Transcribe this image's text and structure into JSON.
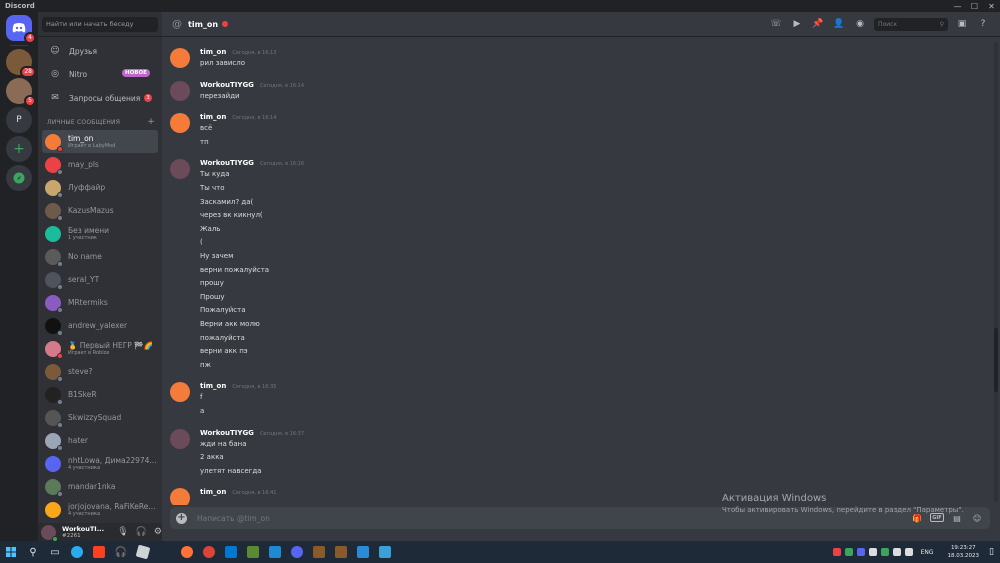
{
  "window": {
    "title": "Discord"
  },
  "guilds": {
    "home_badge": "4",
    "items": [
      {
        "label": "",
        "badge": "28",
        "color": "#7b5a3a"
      },
      {
        "label": "",
        "badge": "5",
        "color": "#8a6b55"
      },
      {
        "label": "P",
        "badge": "",
        "color": "#36393f"
      }
    ]
  },
  "sidebar": {
    "search_placeholder": "Найти или начать беседу",
    "friends": "Друзья",
    "nitro": "Nitro",
    "nitro_badge": "НОВОЕ",
    "requests": "Запросы общения",
    "requests_badge": "3",
    "dm_header": "ЛИЧНЫЕ СООБЩЕНИЯ",
    "dms": [
      {
        "name": "tim_on",
        "sub": "Играет в LabyMod",
        "color": "#f47b3a",
        "status": "#ed4245"
      },
      {
        "name": "may_pls",
        "sub": "",
        "color": "#ed4245",
        "status": "#747f8d"
      },
      {
        "name": "Луффайр",
        "sub": "",
        "color": "#c9a66b",
        "status": "#747f8d"
      },
      {
        "name": "KazusMazus",
        "sub": "",
        "color": "#6d5a4a",
        "status": "#747f8d"
      },
      {
        "name": "Без имени",
        "sub": "1 участник",
        "color": "#1abc9c",
        "status": ""
      },
      {
        "name": "No name",
        "sub": "",
        "color": "#5a5a5a",
        "status": "#747f8d"
      },
      {
        "name": "seral_YT",
        "sub": "",
        "color": "#4f545c",
        "status": "#747f8d"
      },
      {
        "name": "MRtermiks",
        "sub": "",
        "color": "#8a5cc2",
        "status": "#747f8d"
      },
      {
        "name": "andrew_yalexer",
        "sub": "",
        "color": "#111111",
        "status": "#747f8d"
      },
      {
        "name": "🥇 Первый НЕГР 🏁🌈",
        "sub": "Играет в Roblox",
        "color": "#d47a8a",
        "status": "#ed4245"
      },
      {
        "name": "steve?",
        "sub": "",
        "color": "#7a5a3a",
        "status": "#747f8d"
      },
      {
        "name": "B1SkeR",
        "sub": "",
        "color": "#222222",
        "status": "#747f8d"
      },
      {
        "name": "SkwizzySquad",
        "sub": "",
        "color": "#555555",
        "status": "#747f8d"
      },
      {
        "name": "hater",
        "sub": "",
        "color": "#9aa5b5",
        "status": "#747f8d"
      },
      {
        "name": "nhtLowa, Дима22974...",
        "sub": "4 участника",
        "color": "#5865f2",
        "status": ""
      },
      {
        "name": "mandar1nka",
        "sub": "",
        "color": "#5a7a5a",
        "status": "#747f8d"
      },
      {
        "name": "jorjojovana, RaFiKeRe...",
        "sub": "4 участника",
        "color": "#faa61a",
        "status": ""
      }
    ]
  },
  "user_panel": {
    "name": "WorkouTI...",
    "tag": "#2261"
  },
  "header": {
    "channel": "tim_on",
    "search_placeholder": "Поиск"
  },
  "messages": [
    {
      "author": "tim_on",
      "time": "Сегодня, в 16:13",
      "avatar": "#f47b3a",
      "lines": [
        "рил зависло"
      ]
    },
    {
      "author": "WorkouTIYGG",
      "time": "Сегодня, в 16:14",
      "avatar": "#6b4b5a",
      "lines": [
        "перезайди"
      ]
    },
    {
      "author": "tim_on",
      "time": "Сегодня, в 16:14",
      "avatar": "#f47b3a",
      "lines": [
        "всё",
        "тп"
      ]
    },
    {
      "author": "WorkouTIYGG",
      "time": "Сегодня, в 16:16",
      "avatar": "#6b4b5a",
      "lines": [
        "Ты куда",
        "Ты что",
        "Заскамил? да(",
        "через вк кикнул(",
        "Жаль",
        "(",
        "Ну зачем",
        "верни пожалуйста",
        "прошу",
        "Прошу",
        "Пожалуйста",
        "Верни акк молю",
        "пожалуйста",
        "верни акк пэ",
        "пж"
      ]
    },
    {
      "author": "tim_on",
      "time": "Сегодня, в 16:35",
      "avatar": "#f47b3a",
      "lines": [
        "f",
        "a"
      ]
    },
    {
      "author": "WorkouTIYGG",
      "time": "Сегодня, в 16:37",
      "avatar": "#6b4b5a",
      "lines": [
        "жди на бана",
        "2 акка",
        "улетят навсегда"
      ]
    },
    {
      "author": "tim_on",
      "time": "Сегодня, в 16:41",
      "avatar": "#f47b3a",
      "lines": []
    }
  ],
  "composer": {
    "placeholder": "Написать @tim_on"
  },
  "activation": {
    "title": "Активация Windows",
    "text": "Чтобы активировать Windows, перейдите в раздел \"Параметры\"."
  },
  "taskbar": {
    "lang": "ENG",
    "time": "19:23:27",
    "date": "18.03.2023"
  }
}
